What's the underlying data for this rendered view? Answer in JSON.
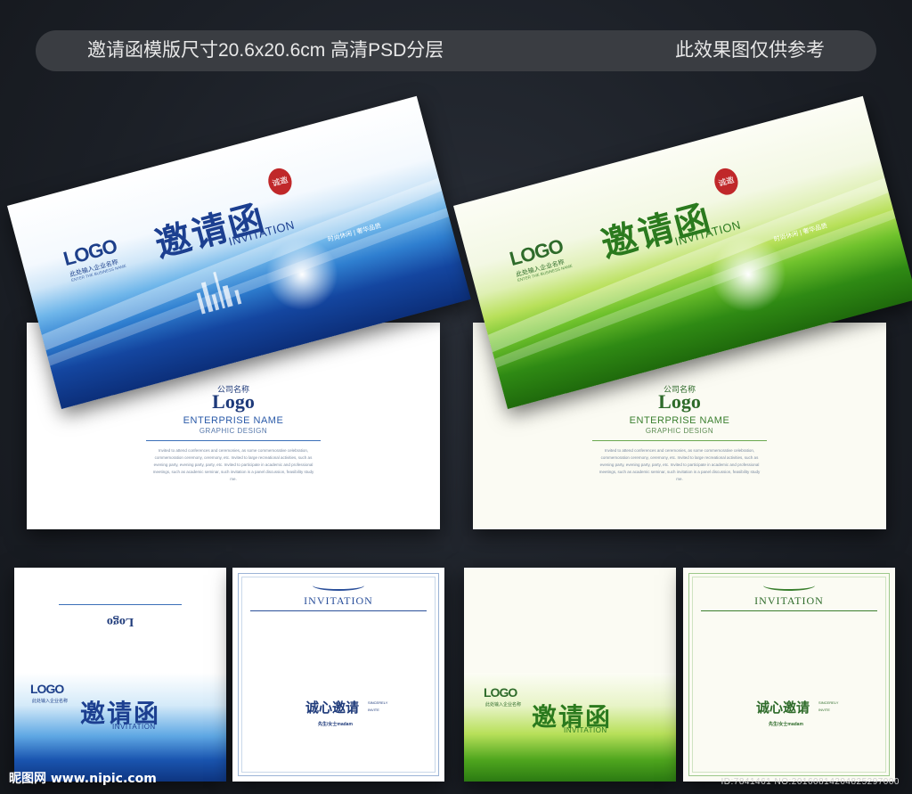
{
  "banner": {
    "left": "邀请函模版尺寸20.6x20.6cm  高清PSD分层",
    "right": "此效果图仅供参考"
  },
  "card": {
    "logo": "LOGO",
    "company_placeholder": "此处输入企业名称",
    "business_line": "ENTER THE BUSINESS NAME",
    "title_cn": "邀请函",
    "title_en": "INVITATION",
    "tagline": "时尚休闲 | 奢华品质",
    "seal_text": "诚邀",
    "inner": {
      "company": "公司名称",
      "logo": "Logo",
      "enterprise": "ENTERPRISE NAME",
      "graphic": "GRAPHIC DESIGN",
      "body": "Invited to attend conferences and ceremonies, as some commemorative celebration, commemoration ceremony, ceremony, etc. Invited to large recreational activities, such as evening party, evening party, party, etc. Invited to participate in academic and professional meetings, such as academic seminar, such invitation is a panel discussion, feasibility study me."
    }
  },
  "inside": {
    "heading": "INVITATION",
    "sincere": "诚心邀请",
    "sincere_en": "SINCERELY INVITE",
    "salutation": "先生/女士madam"
  },
  "footer": {
    "site": "昵图网 www.nipic.com",
    "id": "ID:7841461 NO:20160814204825297000"
  },
  "colors": {
    "blue_dark": "#1446a0",
    "blue_light": "#6fb6ea",
    "green_dark": "#2f8a14",
    "green_light": "#b8e05a",
    "seal_red": "#c0282a"
  }
}
